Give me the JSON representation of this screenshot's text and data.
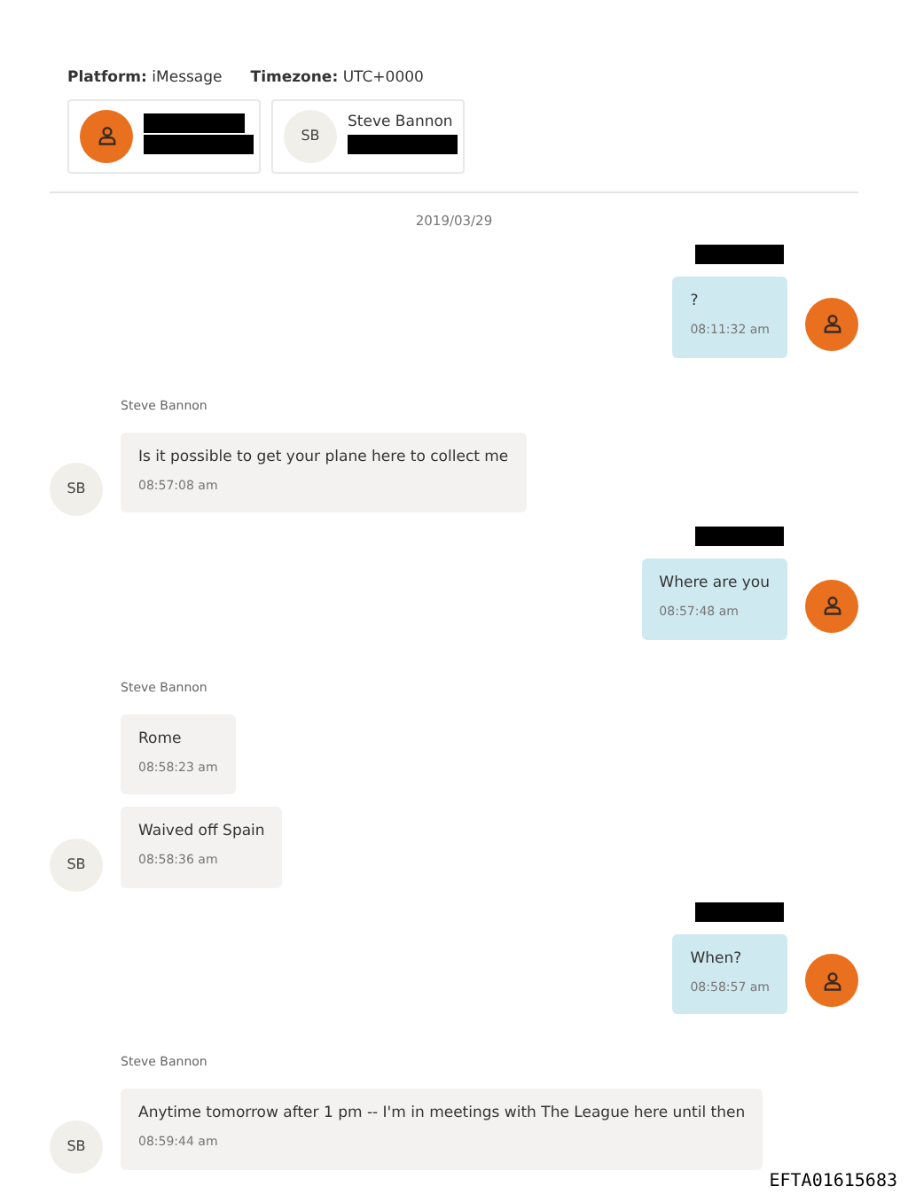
{
  "header": {
    "platform_label": "Platform:",
    "platform": "iMessage",
    "timezone_label": "Timezone:",
    "timezone": "UTC+0000"
  },
  "participants": [
    {
      "avatar": {
        "kind": "icon"
      },
      "name_redacted": true,
      "detail_redacted": true
    },
    {
      "avatar": {
        "kind": "initials",
        "initials": "SB"
      },
      "name": "Steve Bannon",
      "name_redacted": false,
      "detail_redacted": true
    }
  ],
  "date": "2019/03/29",
  "groups": [
    {
      "kind": "outgoing",
      "sender_redacted": true,
      "avatar": {
        "kind": "icon"
      },
      "messages": [
        {
          "text": "?",
          "time": "08:11:32 am"
        }
      ]
    },
    {
      "kind": "incoming",
      "sender": "Steve Bannon",
      "sender_redacted": false,
      "avatar": {
        "kind": "initials",
        "initials": "SB"
      },
      "messages": [
        {
          "text": "Is it possible to get your plane here to collect me",
          "time": "08:57:08 am"
        }
      ]
    },
    {
      "kind": "outgoing",
      "sender_redacted": true,
      "avatar": {
        "kind": "icon"
      },
      "messages": [
        {
          "text": "Where are you",
          "time": "08:57:48 am"
        }
      ]
    },
    {
      "kind": "incoming",
      "sender": "Steve Bannon",
      "sender_redacted": false,
      "avatar": {
        "kind": "initials",
        "initials": "SB"
      },
      "messages": [
        {
          "text": "Rome",
          "time": "08:58:23 am"
        },
        {
          "text": "Waived off Spain",
          "time": "08:58:36 am"
        }
      ]
    },
    {
      "kind": "outgoing",
      "sender_redacted": true,
      "avatar": {
        "kind": "icon"
      },
      "messages": [
        {
          "text": "When?",
          "time": "08:58:57 am"
        }
      ]
    },
    {
      "kind": "incoming",
      "sender": "Steve Bannon",
      "sender_redacted": false,
      "avatar": {
        "kind": "initials",
        "initials": "SB"
      },
      "messages": [
        {
          "text": "Anytime tomorrow after 1 pm -- I'm in meetings with The League here until then",
          "time": "08:59:44 am"
        }
      ]
    }
  ],
  "document_id": "EFTA01615683"
}
